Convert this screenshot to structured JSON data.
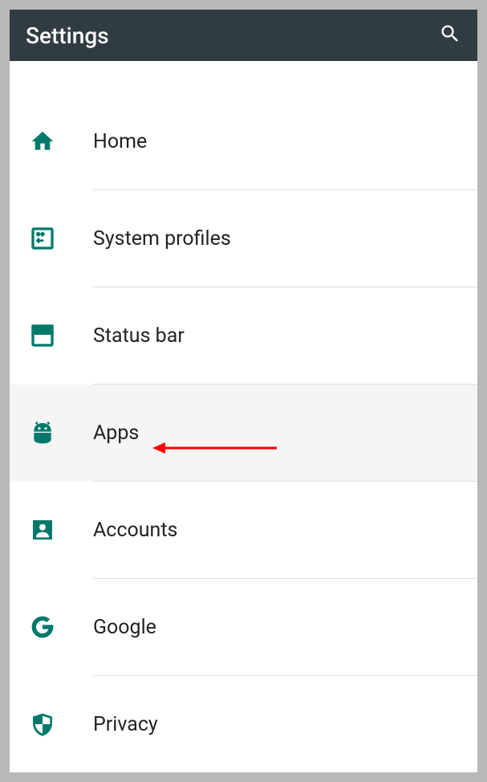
{
  "header": {
    "title": "Settings"
  },
  "items": [
    {
      "label": "Home",
      "icon": "home-icon",
      "highlighted": false
    },
    {
      "label": "System profiles",
      "icon": "profiles-icon",
      "highlighted": false
    },
    {
      "label": "Status bar",
      "icon": "statusbar-icon",
      "highlighted": false
    },
    {
      "label": "Apps",
      "icon": "apps-icon",
      "highlighted": true
    },
    {
      "label": "Accounts",
      "icon": "accounts-icon",
      "highlighted": false
    },
    {
      "label": "Google",
      "icon": "google-icon",
      "highlighted": false
    },
    {
      "label": "Privacy",
      "icon": "privacy-icon",
      "highlighted": false
    }
  ],
  "colors": {
    "accent": "#00796b",
    "header_bg": "#2f3d42",
    "annotation": "#ff0000"
  }
}
